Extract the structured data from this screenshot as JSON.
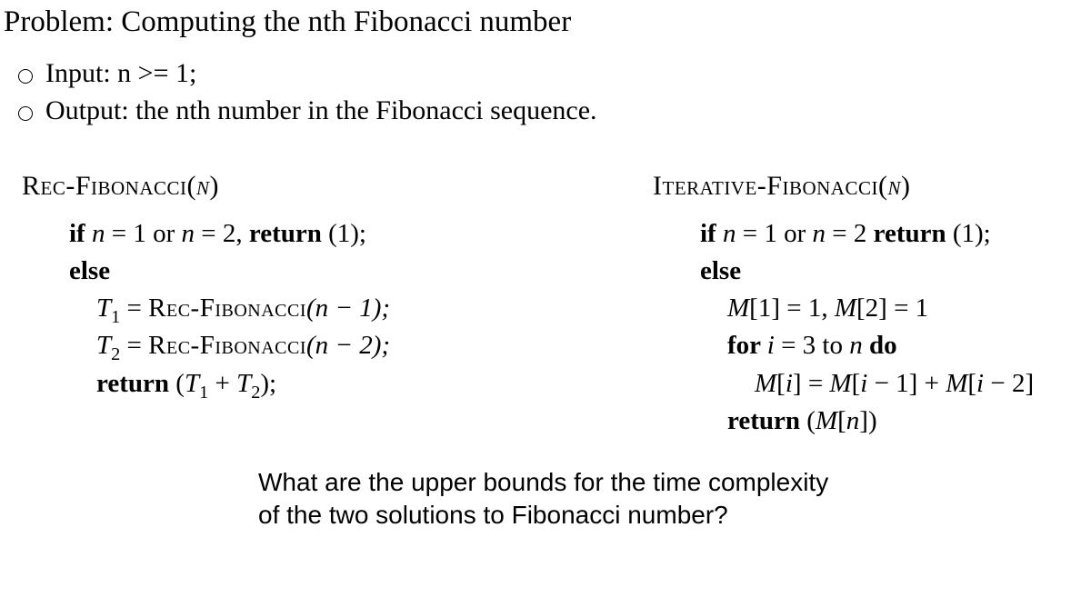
{
  "title": "Problem: Computing the nth Fibonacci number",
  "bullets": {
    "input": "Input: n  >= 1;",
    "output": "Output: the nth number in the Fibonacci sequence."
  },
  "rec": {
    "name_pre": "Rec-Fibonacci",
    "name_arg": "n",
    "l1_if": "if ",
    "l1_cond_a": "n",
    "l1_eq": " = 1 or ",
    "l1_cond_b": "n",
    "l1_eq2": " = 2, ",
    "l1_ret": "return",
    "l1_val": " (1);",
    "l2_else": "else",
    "l3_t1lhs": "T",
    "l3_t1sub": "1",
    "l3_eq": " = ",
    "l3_call": "Rec-Fibonacci",
    "l3_arg": "(n − 1);",
    "l4_t2lhs": "T",
    "l4_t2sub": "2",
    "l4_eq": " = ",
    "l4_call": "Rec-Fibonacci",
    "l4_arg": "(n − 2);",
    "l5_ret": "return",
    "l5_open": " (",
    "l5_T1": "T",
    "l5_T1sub": "1",
    "l5_plus": " + ",
    "l5_T2": "T",
    "l5_T2sub": "2",
    "l5_close": ");"
  },
  "iter": {
    "name_pre": "Iterative-Fibonacci",
    "name_arg": "n",
    "l1_if": "if ",
    "l1_cond_a": "n",
    "l1_eq": " = 1 or ",
    "l1_cond_b": "n",
    "l1_eq2": " = 2 ",
    "l1_ret": "return",
    "l1_val": " (1);",
    "l2_else": "else",
    "l3_M1": "M",
    "l3_b1": "[1] = 1,  ",
    "l3_M2": "M",
    "l3_b2": "[2] = 1",
    "l4_for": "for ",
    "l4_i": "i",
    "l4_rng": " = 3 to ",
    "l4_n": "n",
    "l4_do": " do",
    "l5_Mi": "M",
    "l5_bi": "[",
    "l5_i": "i",
    "l5_bi2": "] = ",
    "l5_Mi1": "M",
    "l5_bi1o": "[",
    "l5_i1": "i",
    "l5_bi1c": " − 1] + ",
    "l5_Mi2": "M",
    "l5_bi2o": "[",
    "l5_i2": "i",
    "l5_bi2c": " − 2]",
    "l6_ret": "return",
    "l6_open": " (",
    "l6_M": "M",
    "l6_bo": "[",
    "l6_n": "n",
    "l6_bc": "])"
  },
  "question": {
    "line1": "What are the upper bounds for the time complexity",
    "line2": "of the two solutions to Fibonacci number?"
  }
}
